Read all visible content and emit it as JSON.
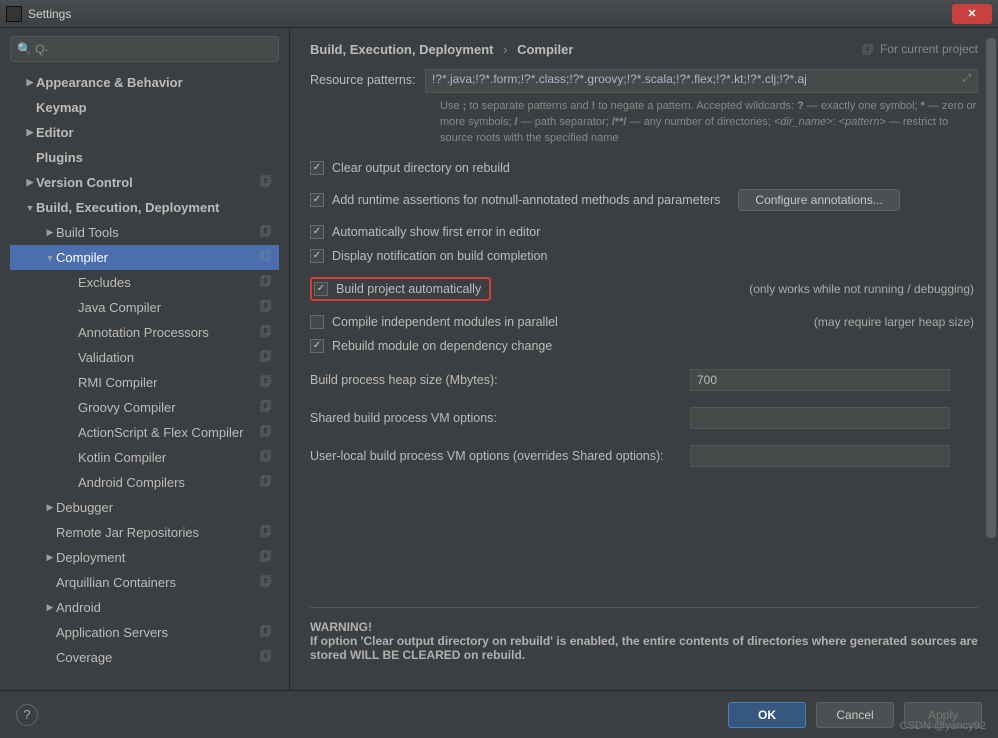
{
  "window": {
    "title": "Settings"
  },
  "search": {
    "placeholder": "Q-"
  },
  "sidebar": {
    "items": [
      {
        "label": "Appearance & Behavior",
        "level": 1,
        "bold": true,
        "arrow": "▶"
      },
      {
        "label": "Keymap",
        "level": 1,
        "bold": true
      },
      {
        "label": "Editor",
        "level": 1,
        "bold": true,
        "arrow": "▶"
      },
      {
        "label": "Plugins",
        "level": 1,
        "bold": true
      },
      {
        "label": "Version Control",
        "level": 1,
        "bold": true,
        "arrow": "▶",
        "copy": true
      },
      {
        "label": "Build, Execution, Deployment",
        "level": 1,
        "bold": true,
        "arrow": "▼"
      },
      {
        "label": "Build Tools",
        "level": 2,
        "arrow": "▶",
        "copy": true
      },
      {
        "label": "Compiler",
        "level": 2,
        "arrow": "▼",
        "copy": true,
        "selected": true
      },
      {
        "label": "Excludes",
        "level": 3,
        "copy": true
      },
      {
        "label": "Java Compiler",
        "level": 3,
        "copy": true
      },
      {
        "label": "Annotation Processors",
        "level": 3,
        "copy": true
      },
      {
        "label": "Validation",
        "level": 3,
        "copy": true
      },
      {
        "label": "RMI Compiler",
        "level": 3,
        "copy": true
      },
      {
        "label": "Groovy Compiler",
        "level": 3,
        "copy": true
      },
      {
        "label": "ActionScript & Flex Compiler",
        "level": 3,
        "copy": true
      },
      {
        "label": "Kotlin Compiler",
        "level": 3,
        "copy": true
      },
      {
        "label": "Android Compilers",
        "level": 3,
        "copy": true
      },
      {
        "label": "Debugger",
        "level": 2,
        "arrow": "▶"
      },
      {
        "label": "Remote Jar Repositories",
        "level": 2,
        "copy": true
      },
      {
        "label": "Deployment",
        "level": 2,
        "arrow": "▶",
        "copy": true
      },
      {
        "label": "Arquillian Containers",
        "level": 2,
        "copy": true
      },
      {
        "label": "Android",
        "level": 2,
        "arrow": "▶"
      },
      {
        "label": "Application Servers",
        "level": 2,
        "copy": true
      },
      {
        "label": "Coverage",
        "level": 2,
        "copy": true
      }
    ]
  },
  "breadcrumb": {
    "parent": "Build, Execution, Deployment",
    "current": "Compiler",
    "scope": "For current project"
  },
  "patterns": {
    "label": "Resource patterns:",
    "value": "!?*.java;!?*.form;!?*.class;!?*.groovy;!?*.scala;!?*.flex;!?*.kt;!?*.clj;!?*.aj",
    "hint_prefix": "Use ",
    "hint_sep": ";",
    "hint_mid": " to separate patterns and ",
    "hint_neg": "!",
    "hint_mid2": " to negate a pattern. Accepted wildcards: ",
    "hint_q": "?",
    "hint_q2": " — exactly one symbol; ",
    "hint_star": "*",
    "hint_star2": " — zero or more symbols; ",
    "hint_slash": "/",
    "hint_slash2": " — path separator; ",
    "hint_dstar": "/**/",
    "hint_dstar2": " — any number of directories; ",
    "hint_dir": "<dir_name>",
    "hint_colon": ": ",
    "hint_pat": "<pattern>",
    "hint_end": " — restrict to source roots with the specified name"
  },
  "checks": {
    "clear": "Clear output directory on rebuild",
    "assertions": "Add runtime assertions for notnull-annotated methods and parameters",
    "cfg_btn": "Configure annotations...",
    "first_error": "Automatically show first error in editor",
    "notify": "Display notification on build completion",
    "auto_build": "Build project automatically",
    "auto_note": "(only works while not running / debugging)",
    "parallel": "Compile independent modules in parallel",
    "parallel_note": "(may require larger heap size)",
    "rebuild_dep": "Rebuild module on dependency change"
  },
  "fields": {
    "heap_label": "Build process heap size (Mbytes):",
    "heap_value": "700",
    "shared_label": "Shared build process VM options:",
    "shared_value": "",
    "user_label": "User-local build process VM options (overrides Shared options):",
    "user_value": ""
  },
  "warning": {
    "title": "WARNING!",
    "text": "If option 'Clear output directory on rebuild' is enabled, the entire contents of directories where generated sources are stored WILL BE CLEARED on rebuild."
  },
  "footer": {
    "ok": "OK",
    "cancel": "Cancel",
    "apply": "Apply"
  },
  "watermark": "CSDN @yancy92"
}
